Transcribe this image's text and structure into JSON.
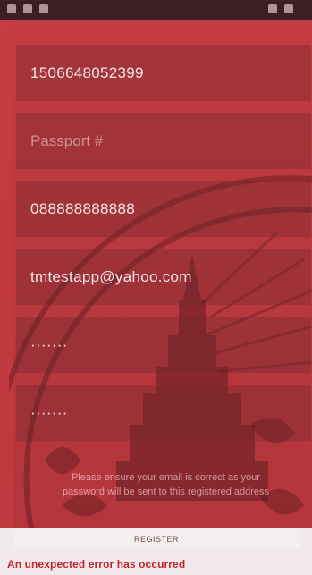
{
  "form": {
    "id_number": "1506648052399",
    "passport_placeholder": "Passport #",
    "phone": "088888888888",
    "email": "tmtestapp@yahoo.com",
    "password_mask": "·······",
    "confirm_password_mask": "·······"
  },
  "notice": {
    "line1": "Please ensure your email is correct as your",
    "line2": "password will be sent to this registered address"
  },
  "register_label": "REGISTER",
  "error_message": "An unexpected error has occurred",
  "colors": {
    "background": "#c43c42",
    "field_bg": "#9a3a40",
    "error": "#c0262d"
  },
  "icons": {
    "watermark": "royal-seal-watermark"
  }
}
